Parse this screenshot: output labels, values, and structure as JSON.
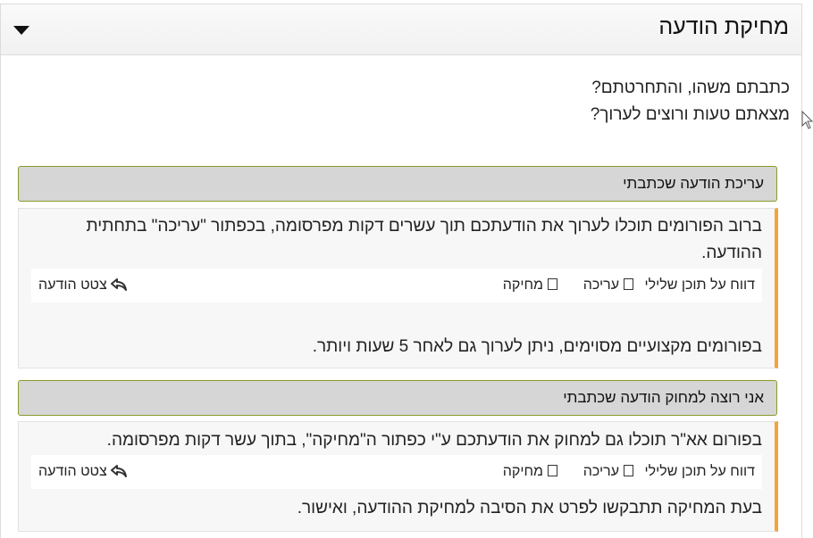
{
  "panel": {
    "title": "מחיקת הודעה"
  },
  "intro": {
    "line1": "כתבתם משהו, והתחרטתם?",
    "line2": "מצאתם טעות ורוצים לערוך?"
  },
  "sections": [
    {
      "header": "עריכת הודעה שכתבתי",
      "text1": "ברוב הפורומים תוכלו לערוך את הודעתכם תוך עשרים דקות מפרסומה, בכפתור \"עריכה\" בתחתית ההודעה.",
      "text2": "בפורומים מקצועיים מסוימים, ניתן לערוך גם לאחר 5 שעות ויותר."
    },
    {
      "header": "אני רוצה למחוק הודעה שכתבתי",
      "text1": "בפורום אא\"ר תוכלו גם למחוק את הודעתכם ע\"י כפתור ה\"מחיקה\", בתוך עשר דקות מפרסומה.",
      "text2": "בעת המחיקה תתבקשו לפרט את הסיבה למחיקת ההודעה, ואישור."
    }
  ],
  "actions": {
    "report": "דווח על תוכן שלילי",
    "edit": "עריכה",
    "delete": "מחיקה",
    "quote": "צטט הודעה"
  },
  "colors": {
    "accent_border": "#f0a53a",
    "header_border": "#8a9a2a",
    "header_bg": "#d6d6d6"
  }
}
